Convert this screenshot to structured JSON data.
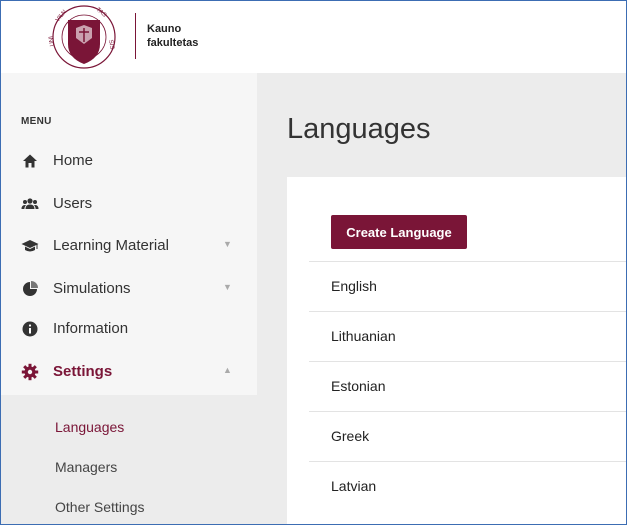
{
  "brand": {
    "seal_label": "UNIVERSITAS VILNENSIS",
    "name_line1": "Kauno",
    "name_line2": "fakultetas",
    "accent_color": "#7a1537"
  },
  "sidebar": {
    "menu_heading": "MENU",
    "items": [
      {
        "label": "Home",
        "icon": "home-icon"
      },
      {
        "label": "Users",
        "icon": "users-icon"
      },
      {
        "label": "Learning Material",
        "icon": "graduation-cap-icon",
        "expandable": true
      },
      {
        "label": "Simulations",
        "icon": "pie-chart-icon",
        "expandable": true
      },
      {
        "label": "Information",
        "icon": "info-icon"
      },
      {
        "label": "Settings",
        "icon": "gear-icon",
        "expanded": true,
        "active": true
      }
    ],
    "submenu": [
      {
        "label": "Languages",
        "active": true
      },
      {
        "label": "Managers"
      },
      {
        "label": "Other Settings"
      }
    ]
  },
  "main": {
    "title": "Languages",
    "create_button": "Create Language",
    "languages": [
      "English",
      "Lithuanian",
      "Estonian",
      "Greek",
      "Latvian"
    ]
  }
}
